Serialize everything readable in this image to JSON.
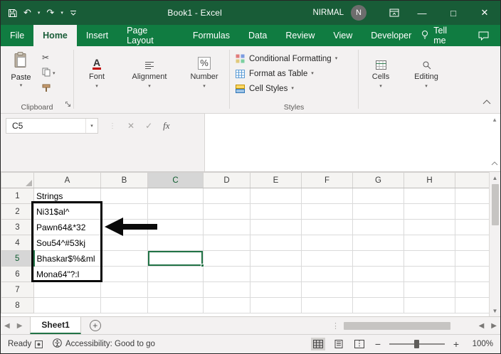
{
  "colors": {
    "titlebar_green": "#185C37",
    "ribbon_green": "#107C41",
    "accent_green": "#217346"
  },
  "titlebar": {
    "title": "Book1 - Excel",
    "user_name": "NIRMAL",
    "avatar_initial": "N"
  },
  "tabs": {
    "items": [
      "File",
      "Home",
      "Insert",
      "Page Layout",
      "Formulas",
      "Data",
      "Review",
      "View",
      "Developer"
    ],
    "active": "Home",
    "tell_me": "Tell me"
  },
  "ribbon": {
    "clipboard": {
      "paste": "Paste",
      "group_label": "Clipboard"
    },
    "collapsed_groups": {
      "font": "Font",
      "alignment": "Alignment",
      "number": "Number",
      "cells": "Cells",
      "editing": "Editing"
    },
    "styles": {
      "items": [
        "Conditional Formatting",
        "Format as Table",
        "Cell Styles"
      ],
      "group_label": "Styles"
    }
  },
  "formula_bar": {
    "name_box": "C5",
    "fx_label": "fx"
  },
  "grid": {
    "column_headers": [
      "A",
      "B",
      "C",
      "D",
      "E",
      "F",
      "G",
      "H"
    ],
    "row_headers": [
      "1",
      "2",
      "3",
      "4",
      "5",
      "6",
      "7",
      "8"
    ],
    "cells": {
      "A1": "Strings",
      "A2": "Ni31$al^",
      "A3": "Pawn64&*32",
      "A4": "Sou54^#53kj",
      "A5": "Bhaskar$%&ml",
      "A6": "Mona64\"?:l"
    },
    "selected_cell": "C5",
    "selected_column": "C",
    "selected_row": "5"
  },
  "sheet_bar": {
    "sheet_name": "Sheet1"
  },
  "status_bar": {
    "mode": "Ready",
    "accessibility": "Accessibility: Good to go",
    "zoom_level": "100%"
  }
}
